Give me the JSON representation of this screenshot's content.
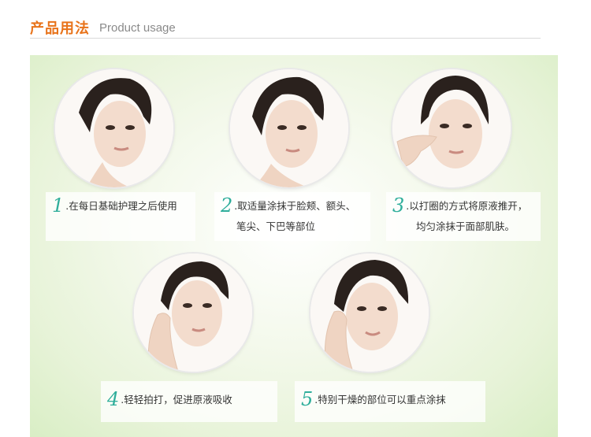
{
  "header": {
    "title_cn": "产品用法",
    "title_en": "Product usage"
  },
  "steps": [
    {
      "num": "1",
      "text": ".在每日基础护理之后使用",
      "text2": ""
    },
    {
      "num": "2",
      "text": ".取适量涂抹于脸颊、额头、",
      "text2": "笔尖、下巴等部位"
    },
    {
      "num": "3",
      "text": ".以打圈的方式将原液推开，",
      "text2": "均匀涂抹于面部肌肤。"
    },
    {
      "num": "4",
      "text": ".轻轻拍打，促进原液吸收",
      "text2": ""
    },
    {
      "num": "5",
      "text": ".特别干燥的部位可以重点涂抹",
      "text2": ""
    }
  ],
  "colors": {
    "title": "#e8731a",
    "step_number": "#2fae9b",
    "panel": "#e7f3d8"
  }
}
